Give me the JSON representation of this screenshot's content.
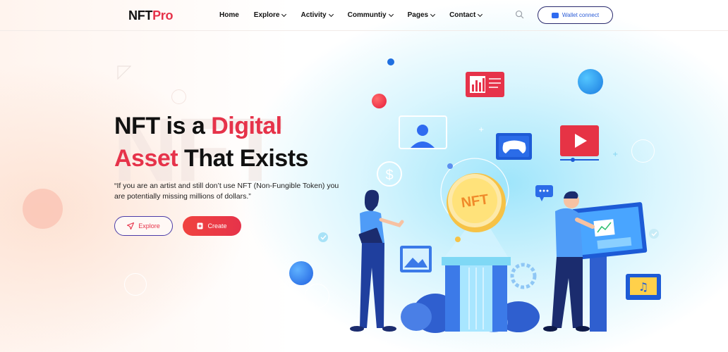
{
  "brand": {
    "logo_nft": "NFT",
    "logo_pro": "Pro"
  },
  "nav": {
    "items": [
      {
        "label": "Home",
        "has_dropdown": false
      },
      {
        "label": "Explore",
        "has_dropdown": true
      },
      {
        "label": "Activity",
        "has_dropdown": true
      },
      {
        "label": "Communtiy",
        "has_dropdown": true
      },
      {
        "label": "Pages",
        "has_dropdown": true
      },
      {
        "label": "Contact",
        "has_dropdown": true
      }
    ],
    "wallet_label": "Wallet connect"
  },
  "hero": {
    "ghost_text": "NFT",
    "title_part1": "NFT is a ",
    "title_highlight1": "Digital",
    "title_highlight2": "Asset",
    "title_part2": " That Exists",
    "description": "“If you are an artist and still don’t use NFT (Non-Fungible Token) you are potentially missing millions of dollars.”",
    "explore_label": "Explore",
    "create_label": "Create",
    "coin_label": "NFT"
  },
  "colors": {
    "accent": "#e6334a",
    "navy": "#2a2b6e",
    "blue": "#2f6bf0"
  }
}
